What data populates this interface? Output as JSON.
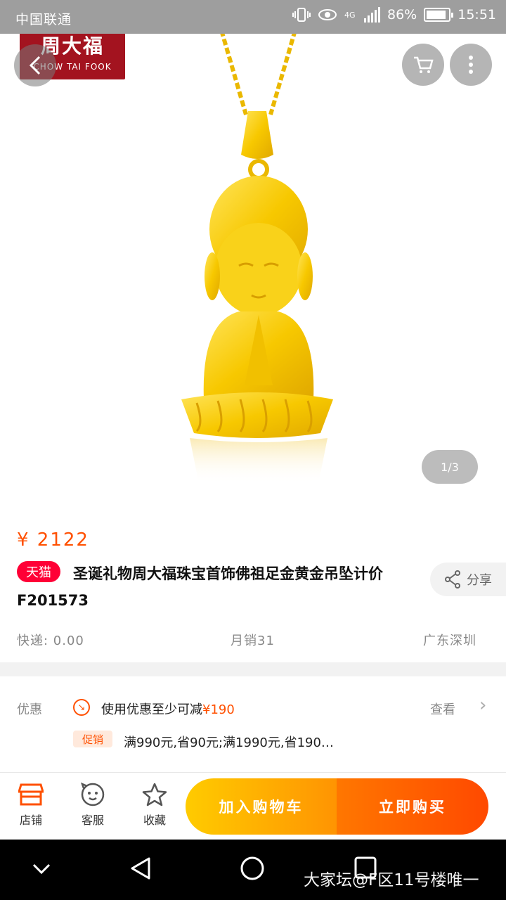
{
  "status_bar": {
    "carrier": "中国联通",
    "network": "4G",
    "battery": "86%",
    "time": "15:51"
  },
  "brand": {
    "logo_cn": "周大福",
    "logo_en": "CHOW TAI FOOK",
    "color": "#a3131f"
  },
  "gallery": {
    "pager": "1/3"
  },
  "product": {
    "price": "¥ 2122",
    "platform_badge": "天猫",
    "title": "圣诞礼物周大福珠宝首饰佛祖足金黄金吊坠计价F201573",
    "share_label": "分享",
    "shipping": "快递: 0.00",
    "monthly_sales": "月销31",
    "location": "广东深圳"
  },
  "promotion": {
    "label": "优惠",
    "coupon_prefix": "使用优惠至少可减",
    "coupon_amount": "¥190",
    "view_label": "查看",
    "promo_badge": "促销",
    "promo_text": "满990元,省90元;满1990元,省190…"
  },
  "action_bar": {
    "shop": "店铺",
    "service": "客服",
    "favorite": "收藏",
    "add_to_cart": "加入购物车",
    "buy_now": "立即购买"
  },
  "watermark": "大家坛@F区11号楼唯一",
  "colors": {
    "accent": "#ff5000",
    "tmall": "#ff0036",
    "gold": "#f5c400"
  }
}
